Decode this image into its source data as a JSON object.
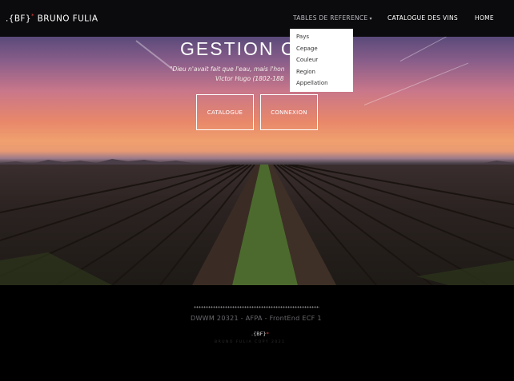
{
  "navbar": {
    "brand_logo": ".{BF}",
    "brand_star": "*",
    "brand_name": "BRUNO FULIA",
    "items": [
      {
        "label": "TABLES DE REFERENCE",
        "caret": "▾"
      },
      {
        "label": "CATALOGUE DES VINS"
      },
      {
        "label": "HOME"
      }
    ]
  },
  "dropdown": {
    "items": [
      "Pays",
      "Cepage",
      "Couleur",
      "Region",
      "Appellation"
    ]
  },
  "hero": {
    "title": "GESTION C",
    "quote": "\"Dieu n'avait fait que l'eau, mais l'hon",
    "quote_author": "Victor Hugo (1802-188",
    "buttons": [
      {
        "label": "CATALOGUE"
      },
      {
        "label": "CONNEXION"
      }
    ]
  },
  "footer": {
    "credit": "DWWM 20321 - AFPA - FrontEnd ECF 1",
    "mini_logo": ".{BF}",
    "mini_star": "*",
    "copyright": "BRUNO FULIA COPY 2021"
  },
  "colors": {
    "navbar_bg": "#0b0b0d",
    "accent_star": "#e0403a",
    "footer_bg": "#000000"
  }
}
